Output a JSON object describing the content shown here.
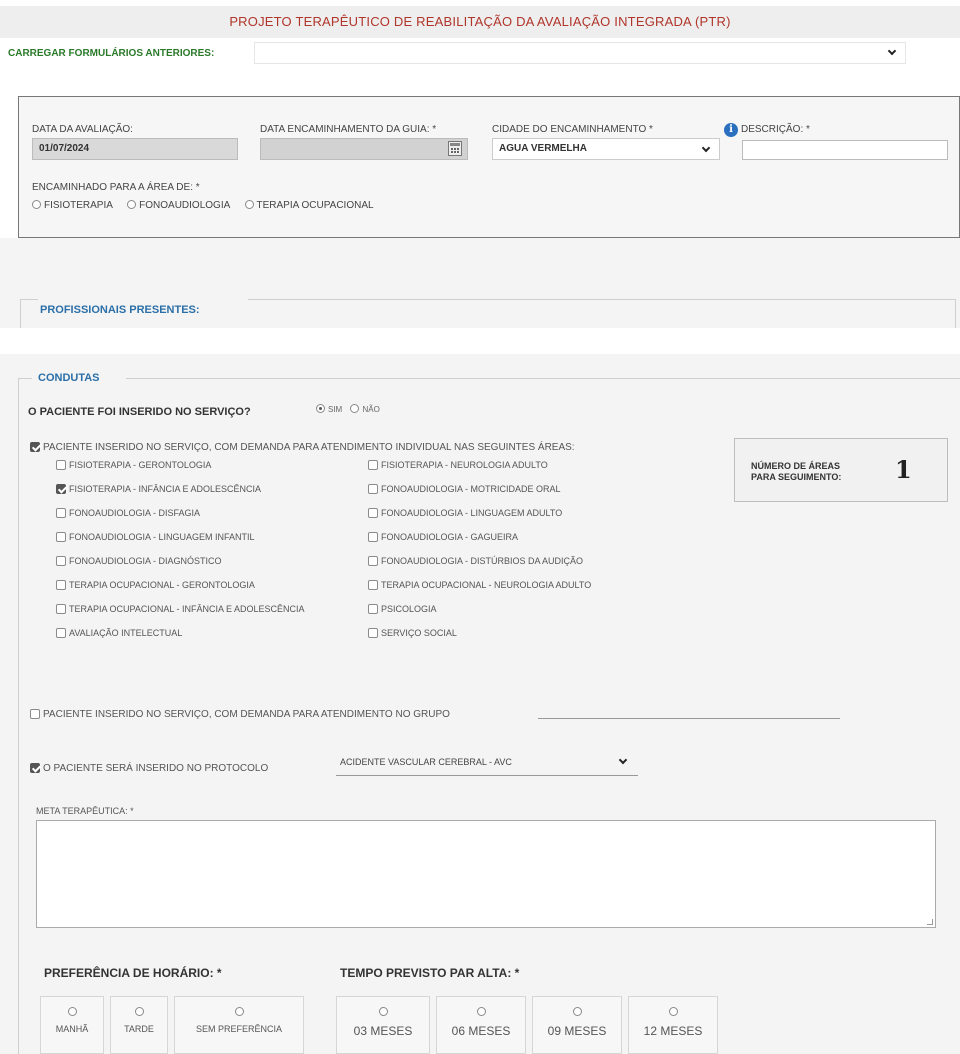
{
  "title": "PROJETO TERAPÊUTICO DE REABILITAÇÃO DA AVALIAÇÃO INTEGRADA (PTR)",
  "load": {
    "label": "CARREGAR FORMULÁRIOS ANTERIORES:",
    "value": ""
  },
  "evaluation": {
    "date_label": "DATA DA AVALIAÇÃO:",
    "date_value": "01/07/2024",
    "guide_date_label": "DATA ENCAMINHAMENTO DA GUIA: *",
    "guide_date_value": "",
    "city_label": "CIDADE DO ENCAMINHAMENTO *",
    "city_value": "AGUA VERMELHA",
    "desc_label": "DESCRIÇÃO: *",
    "desc_value": "",
    "area_label": "ENCAMINHADO PARA A ÁREA DE: *",
    "areas": [
      "FISIOTERAPIA",
      "FONOAUDIOLOGIA",
      "TERAPIA OCUPACIONAL"
    ]
  },
  "professionals": {
    "legend": "PROFISSIONAIS PRESENTES:"
  },
  "condutas": {
    "legend": "CONDUTAS",
    "inserted_question": "O PACIENTE FOI INSERIDO NO SERVIÇO?",
    "yes": "SIM",
    "no": "NÃO",
    "inserted_yes_selected": true,
    "individual_label": "PACIENTE INSERIDO NO SERVIÇO, COM DEMANDA PARA ATENDIMENTO INDIVIDUAL NAS SEGUINTES ÁREAS:",
    "individual_checked": true,
    "areas_left": [
      {
        "label": "FISIOTERAPIA - GERONTOLOGIA",
        "checked": false
      },
      {
        "label": "FISIOTERAPIA - INFÂNCIA E ADOLESCÊNCIA",
        "checked": true
      },
      {
        "label": "FONOAUDIOLOGIA - DISFAGIA",
        "checked": false
      },
      {
        "label": "FONOAUDIOLOGIA - LINGUAGEM INFANTIL",
        "checked": false
      },
      {
        "label": "FONOAUDIOLOGIA - DIAGNÓSTICO",
        "checked": false
      },
      {
        "label": "TERAPIA OCUPACIONAL - GERONTOLOGIA",
        "checked": false
      },
      {
        "label": "TERAPIA OCUPACIONAL - INFÂNCIA E ADOLESCÊNCIA",
        "checked": false
      },
      {
        "label": "AVALIAÇÃO INTELECTUAL",
        "checked": false
      }
    ],
    "areas_right": [
      {
        "label": "FISIOTERAPIA - NEUROLOGIA ADULTO",
        "checked": false
      },
      {
        "label": "FONOAUDIOLOGIA - MOTRICIDADE ORAL",
        "checked": false
      },
      {
        "label": "FONOAUDIOLOGIA - LINGUAGEM ADULTO",
        "checked": false
      },
      {
        "label": "FONOAUDIOLOGIA - GAGUEIRA",
        "checked": false
      },
      {
        "label": "FONOAUDIOLOGIA - DISTÚRBIOS DA AUDIÇÃO",
        "checked": false
      },
      {
        "label": "TERAPIA OCUPACIONAL - NEUROLOGIA ADULTO",
        "checked": false
      },
      {
        "label": "PSICOLOGIA",
        "checked": false
      },
      {
        "label": "SERVIÇO SOCIAL",
        "checked": false
      }
    ],
    "counter_label_1": "NÚMERO DE ÁREAS",
    "counter_label_2": "PARA SEGUIMENTO:",
    "counter_value": "1",
    "group_label": "PACIENTE INSERIDO NO SERVIÇO, COM DEMANDA PARA ATENDIMENTO NO GRUPO",
    "group_checked": false,
    "group_value": "",
    "protocol_label": "O PACIENTE SERÁ INSERIDO NO PROTOCOLO",
    "protocol_checked": true,
    "protocol_value": "ACIDENTE VASCULAR CEREBRAL - AVC",
    "meta_label": "META TERAPÊUTICA: *",
    "meta_value": "",
    "schedule_label": "PREFERÊNCIA DE HORÁRIO: *",
    "schedule_options": [
      "MANHÃ",
      "TARDE",
      "SEM PREFERÊNCIA"
    ],
    "discharge_label": "TEMPO PREVISTO PAR ALTA: *",
    "discharge_options": [
      "03 MESES",
      "06 MESES",
      "09 MESES",
      "12 MESES"
    ]
  },
  "colors": {
    "title": "#b0352a",
    "load_label": "#2a7a2a",
    "legend": "#2b6fa8",
    "info_icon": "#2b6fbf"
  },
  "icons": [
    "chevron-down-icon",
    "calendar-icon",
    "info-icon"
  ]
}
